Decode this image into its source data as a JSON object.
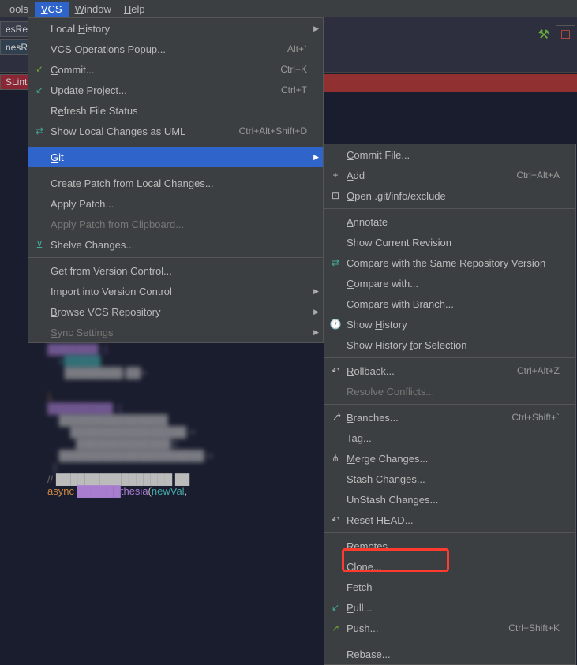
{
  "menubar": {
    "tools": "ools",
    "vcs": "VCS",
    "window": "Window",
    "help": "Help"
  },
  "sidebar": {
    "tab1": "esRe",
    "tab2": "nesRe",
    "tab3": "SLint"
  },
  "vcs_menu": [
    {
      "label": "Local History",
      "u": "H",
      "submenu": true
    },
    {
      "label": "VCS Operations Popup...",
      "u": "O",
      "shortcut": "Alt+`"
    },
    {
      "label": "Commit...",
      "u": "C",
      "icon": "✓",
      "icon_color": "green",
      "shortcut": "Ctrl+K"
    },
    {
      "label": "Update Project...",
      "u": "U",
      "icon": "↙",
      "icon_color": "blue",
      "shortcut": "Ctrl+T"
    },
    {
      "label": "Refresh File Status",
      "u": "e"
    },
    {
      "label": "Show Local Changes as UML",
      "u": "",
      "icon": "↔",
      "icon_color": "blue",
      "shortcut": "Ctrl+Alt+Shift+D"
    },
    {
      "sep": true
    },
    {
      "label": "Git",
      "u": "G",
      "submenu": true,
      "highlighted": true
    },
    {
      "sep": true
    },
    {
      "label": "Create Patch from Local Changes...",
      "u": ""
    },
    {
      "label": "Apply Patch...",
      "u": ""
    },
    {
      "label": "Apply Patch from Clipboard...",
      "u": "",
      "disabled": true
    },
    {
      "label": "Shelve Changes...",
      "u": "",
      "icon": "⊻",
      "icon_color": "blue"
    },
    {
      "sep": true
    },
    {
      "label": "Get from Version Control...",
      "u": ""
    },
    {
      "label": "Import into Version Control",
      "u": "",
      "submenu": true
    },
    {
      "label": "Browse VCS Repository",
      "u": "B",
      "submenu": true
    },
    {
      "label": "Sync Settings",
      "u": "S",
      "disabled": true,
      "submenu": true
    }
  ],
  "git_submenu": [
    {
      "label": "Commit File...",
      "u": "C"
    },
    {
      "label": "Add",
      "u": "A",
      "icon": "+",
      "shortcut": "Ctrl+Alt+A"
    },
    {
      "label": "Open .git/info/exclude",
      "u": "O",
      "icon": "⊡"
    },
    {
      "sep": true
    },
    {
      "label": "Annotate",
      "u": "A"
    },
    {
      "label": "Show Current Revision",
      "u": ""
    },
    {
      "label": "Compare with the Same Repository Version",
      "u": "",
      "icon": "↔",
      "icon_color": "blue"
    },
    {
      "label": "Compare with...",
      "u": "C"
    },
    {
      "label": "Compare with Branch...",
      "u": ""
    },
    {
      "label": "Show History",
      "u": "H",
      "icon": "🕐"
    },
    {
      "label": "Show History for Selection",
      "u": "f"
    },
    {
      "sep": true
    },
    {
      "label": "Rollback...",
      "u": "R",
      "icon": "↶",
      "shortcut": "Ctrl+Alt+Z"
    },
    {
      "label": "Resolve Conflicts...",
      "u": "",
      "disabled": true
    },
    {
      "sep": true
    },
    {
      "label": "Branches...",
      "u": "B",
      "icon": "⎇",
      "shortcut": "Ctrl+Shift+`"
    },
    {
      "label": "Tag...",
      "u": ""
    },
    {
      "label": "Merge Changes...",
      "u": "M",
      "icon": "⋔"
    },
    {
      "label": "Stash Changes...",
      "u": ""
    },
    {
      "label": "UnStash Changes...",
      "u": ""
    },
    {
      "label": "Reset HEAD...",
      "u": "",
      "icon": "↶"
    },
    {
      "sep": true
    },
    {
      "label": "Remotes...",
      "u": ""
    },
    {
      "label": "Clone...",
      "u": ""
    },
    {
      "label": "Fetch",
      "u": ""
    },
    {
      "label": "Pull...",
      "u": "P",
      "icon": "↙",
      "icon_color": "blue"
    },
    {
      "label": "Push...",
      "u": "P",
      "icon": "↗",
      "icon_color": "green",
      "shortcut": "Ctrl+Shift+K"
    },
    {
      "sep": true
    },
    {
      "label": "Rebase...",
      "u": ""
    }
  ],
  "code": {
    "brace": "},",
    "comment": "// ...",
    "async": "async"
  }
}
